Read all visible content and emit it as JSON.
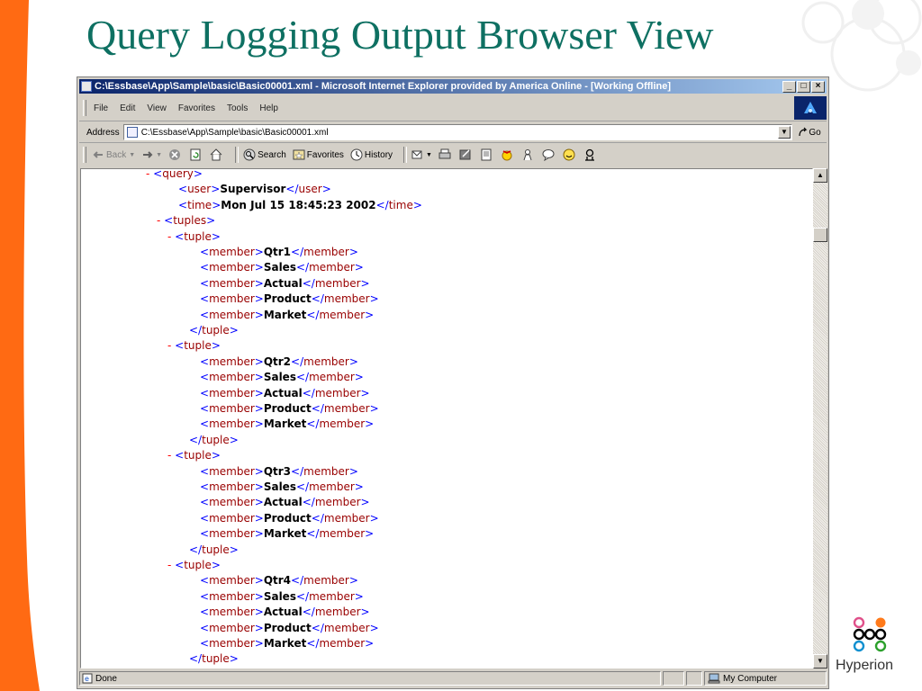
{
  "slide": {
    "title": "Query Logging Output Browser View",
    "title_color": "#0e7062",
    "accent_color": "#ff6a13",
    "logo_text": "Hyperion"
  },
  "window": {
    "title": "C:\\Essbase\\App\\Sample\\basic\\Basic00001.xml - Microsoft Internet Explorer provided by America Online - [Working Offline]",
    "minimize": "_",
    "maximize": "□",
    "close": "×"
  },
  "menu": [
    "File",
    "Edit",
    "View",
    "Favorites",
    "Tools",
    "Help"
  ],
  "address": {
    "label": "Address",
    "value": "C:\\Essbase\\App\\Sample\\basic\\Basic00001.xml",
    "go_label": "Go"
  },
  "toolbar": {
    "back": "Back",
    "search": "Search",
    "favorites": "Favorites",
    "history": "History"
  },
  "xml": {
    "lines": [
      {
        "indent": 3,
        "minus": true,
        "open": "query",
        "value": "",
        "close": "",
        "cut": true
      },
      {
        "indent": 4,
        "minus": false,
        "open": "user",
        "value": "Supervisor",
        "close": "user"
      },
      {
        "indent": 4,
        "minus": false,
        "open": "time",
        "value": "Mon Jul 15 18:45:23 2002",
        "close": "time"
      },
      {
        "indent": 3.5,
        "minus": true,
        "open": "tuples",
        "value": "",
        "close": ""
      },
      {
        "indent": 4,
        "minus": true,
        "open": "tuple",
        "value": "",
        "close": ""
      },
      {
        "indent": 5,
        "minus": false,
        "open": "member",
        "value": "Qtr1",
        "close": "member"
      },
      {
        "indent": 5,
        "minus": false,
        "open": "member",
        "value": "Sales",
        "close": "member"
      },
      {
        "indent": 5,
        "minus": false,
        "open": "member",
        "value": "Actual",
        "close": "member"
      },
      {
        "indent": 5,
        "minus": false,
        "open": "member",
        "value": "Product",
        "close": "member"
      },
      {
        "indent": 5,
        "minus": false,
        "open": "member",
        "value": "Market",
        "close": "member"
      },
      {
        "indent": 4.5,
        "minus": false,
        "open": "",
        "value": "",
        "close": "tuple"
      },
      {
        "indent": 4,
        "minus": true,
        "open": "tuple",
        "value": "",
        "close": ""
      },
      {
        "indent": 5,
        "minus": false,
        "open": "member",
        "value": "Qtr2",
        "close": "member"
      },
      {
        "indent": 5,
        "minus": false,
        "open": "member",
        "value": "Sales",
        "close": "member"
      },
      {
        "indent": 5,
        "minus": false,
        "open": "member",
        "value": "Actual",
        "close": "member"
      },
      {
        "indent": 5,
        "minus": false,
        "open": "member",
        "value": "Product",
        "close": "member"
      },
      {
        "indent": 5,
        "minus": false,
        "open": "member",
        "value": "Market",
        "close": "member"
      },
      {
        "indent": 4.5,
        "minus": false,
        "open": "",
        "value": "",
        "close": "tuple"
      },
      {
        "indent": 4,
        "minus": true,
        "open": "tuple",
        "value": "",
        "close": ""
      },
      {
        "indent": 5,
        "minus": false,
        "open": "member",
        "value": "Qtr3",
        "close": "member"
      },
      {
        "indent": 5,
        "minus": false,
        "open": "member",
        "value": "Sales",
        "close": "member"
      },
      {
        "indent": 5,
        "minus": false,
        "open": "member",
        "value": "Actual",
        "close": "member"
      },
      {
        "indent": 5,
        "minus": false,
        "open": "member",
        "value": "Product",
        "close": "member"
      },
      {
        "indent": 5,
        "minus": false,
        "open": "member",
        "value": "Market",
        "close": "member"
      },
      {
        "indent": 4.5,
        "minus": false,
        "open": "",
        "value": "",
        "close": "tuple"
      },
      {
        "indent": 4,
        "minus": true,
        "open": "tuple",
        "value": "",
        "close": ""
      },
      {
        "indent": 5,
        "minus": false,
        "open": "member",
        "value": "Qtr4",
        "close": "member"
      },
      {
        "indent": 5,
        "minus": false,
        "open": "member",
        "value": "Sales",
        "close": "member"
      },
      {
        "indent": 5,
        "minus": false,
        "open": "member",
        "value": "Actual",
        "close": "member"
      },
      {
        "indent": 5,
        "minus": false,
        "open": "member",
        "value": "Product",
        "close": "member"
      },
      {
        "indent": 5,
        "minus": false,
        "open": "member",
        "value": "Market",
        "close": "member"
      },
      {
        "indent": 4.5,
        "minus": false,
        "open": "",
        "value": "",
        "close": "tuple"
      }
    ]
  },
  "status": {
    "text": "Done",
    "zone": "My Computer"
  }
}
